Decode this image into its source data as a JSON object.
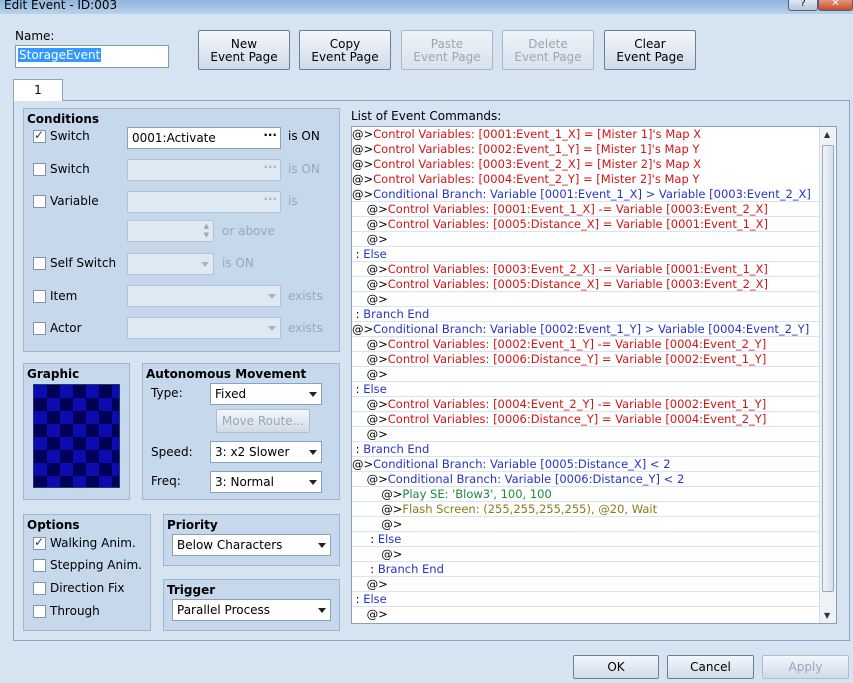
{
  "window": {
    "title": "Edit Event - ID:003",
    "help_glyph": "?",
    "close_glyph": "✕"
  },
  "name": {
    "label": "Name:",
    "value": "StorageEvent"
  },
  "toolbar": {
    "new_page": [
      "New",
      "Event Page"
    ],
    "copy_page": [
      "Copy",
      "Event Page"
    ],
    "paste_page": [
      "Paste",
      "Event Page"
    ],
    "delete_page": [
      "Delete",
      "Event Page"
    ],
    "clear_page": [
      "Clear",
      "Event Page"
    ]
  },
  "tabs": [
    {
      "label": "1"
    }
  ],
  "conditions": {
    "title": "Conditions",
    "switch1": {
      "label": "Switch",
      "checked": true,
      "value": "0001:Activate",
      "suffix": "is ON"
    },
    "switch2": {
      "label": "Switch",
      "checked": false,
      "value": "",
      "suffix": "is ON"
    },
    "variable": {
      "label": "Variable",
      "checked": false,
      "value": "",
      "suffix": "is",
      "or_above": "or above"
    },
    "self_switch": {
      "label": "Self Switch",
      "checked": false,
      "value": "",
      "suffix": "is ON"
    },
    "item": {
      "label": "Item",
      "checked": false,
      "value": "",
      "suffix": "exists"
    },
    "actor": {
      "label": "Actor",
      "checked": false,
      "value": "",
      "suffix": "exists"
    },
    "dots": "···"
  },
  "graphic": {
    "title": "Graphic"
  },
  "movement": {
    "title": "Autonomous Movement",
    "type_label": "Type:",
    "type_value": "Fixed",
    "move_route": "Move Route...",
    "speed_label": "Speed:",
    "speed_value": "3: x2 Slower",
    "freq_label": "Freq:",
    "freq_value": "3: Normal"
  },
  "options": {
    "title": "Options",
    "items": [
      {
        "label": "Walking Anim.",
        "checked": true
      },
      {
        "label": "Stepping Anim.",
        "checked": false
      },
      {
        "label": "Direction Fix",
        "checked": false
      },
      {
        "label": "Through",
        "checked": false
      }
    ]
  },
  "priority": {
    "title": "Priority",
    "value": "Below Characters"
  },
  "trigger": {
    "title": "Trigger",
    "value": "Parallel Process"
  },
  "commands": {
    "title": "List of Event Commands:",
    "rows": [
      {
        "indent": "",
        "prefix": "@>",
        "text": "Control Variables: [0001:Event_1_X] = [Mister 1]'s Map X",
        "color": "red",
        "sep": false
      },
      {
        "indent": "",
        "prefix": "@>",
        "text": "Control Variables: [0002:Event_1_Y] = [Mister 1]'s Map Y",
        "color": "red",
        "sep": false
      },
      {
        "indent": "",
        "prefix": "@>",
        "text": "Control Variables: [0003:Event_2_X] = [Mister 2]'s Map X",
        "color": "red",
        "sep": false
      },
      {
        "indent": "",
        "prefix": "@>",
        "text": "Control Variables: [0004:Event_2_Y] = [Mister 2]'s Map Y",
        "color": "red",
        "sep": false
      },
      {
        "indent": "",
        "prefix": "@>",
        "text": "Conditional Branch: Variable [0001:Event_1_X] > Variable [0003:Event_2_X]",
        "color": "blue",
        "sep": true
      },
      {
        "indent": "    ",
        "prefix": "@>",
        "text": "Control Variables: [0001:Event_1_X] -= Variable [0003:Event_2_X]",
        "color": "red",
        "sep": true
      },
      {
        "indent": "    ",
        "prefix": "@>",
        "text": "Control Variables: [0005:Distance_X] = Variable [0001:Event_1_X]",
        "color": "red",
        "sep": true
      },
      {
        "indent": "    ",
        "prefix": "@>",
        "text": "",
        "color": "black",
        "sep": true
      },
      {
        "indent": "",
        "prefix": " : ",
        "text": "Else",
        "color": "blue",
        "sep": true
      },
      {
        "indent": "    ",
        "prefix": "@>",
        "text": "Control Variables: [0003:Event_2_X] -= Variable [0001:Event_1_X]",
        "color": "red",
        "sep": true
      },
      {
        "indent": "    ",
        "prefix": "@>",
        "text": "Control Variables: [0005:Distance_X] = Variable [0003:Event_2_X]",
        "color": "red",
        "sep": true
      },
      {
        "indent": "    ",
        "prefix": "@>",
        "text": "",
        "color": "black",
        "sep": true
      },
      {
        "indent": "",
        "prefix": " : ",
        "text": "Branch End",
        "color": "blue",
        "sep": true
      },
      {
        "indent": "",
        "prefix": "@>",
        "text": "Conditional Branch: Variable [0002:Event_1_Y] > Variable [0004:Event_2_Y]",
        "color": "blue",
        "sep": true
      },
      {
        "indent": "    ",
        "prefix": "@>",
        "text": "Control Variables: [0002:Event_1_Y] -= Variable [0004:Event_2_Y]",
        "color": "red",
        "sep": true
      },
      {
        "indent": "    ",
        "prefix": "@>",
        "text": "Control Variables: [0006:Distance_Y] = Variable [0002:Event_1_Y]",
        "color": "red",
        "sep": true
      },
      {
        "indent": "    ",
        "prefix": "@>",
        "text": "",
        "color": "black",
        "sep": true
      },
      {
        "indent": "",
        "prefix": " : ",
        "text": "Else",
        "color": "blue",
        "sep": true
      },
      {
        "indent": "    ",
        "prefix": "@>",
        "text": "Control Variables: [0004:Event_2_Y] -= Variable [0002:Event_1_Y]",
        "color": "red",
        "sep": true
      },
      {
        "indent": "    ",
        "prefix": "@>",
        "text": "Control Variables: [0006:Distance_Y] = Variable [0004:Event_2_Y]",
        "color": "red",
        "sep": true
      },
      {
        "indent": "    ",
        "prefix": "@>",
        "text": "",
        "color": "black",
        "sep": true
      },
      {
        "indent": "",
        "prefix": " : ",
        "text": "Branch End",
        "color": "blue",
        "sep": true
      },
      {
        "indent": "",
        "prefix": "@>",
        "text": "Conditional Branch: Variable [0005:Distance_X] < 2",
        "color": "blue",
        "sep": true
      },
      {
        "indent": "    ",
        "prefix": "@>",
        "text": "Conditional Branch: Variable [0006:Distance_Y] < 2",
        "color": "blue",
        "sep": true
      },
      {
        "indent": "        ",
        "prefix": "@>",
        "text": "Play SE: 'Blow3', 100, 100",
        "color": "green",
        "sep": true
      },
      {
        "indent": "        ",
        "prefix": "@>",
        "text": "Flash Screen: (255,255,255,255), @20, Wait",
        "color": "olive",
        "sep": true
      },
      {
        "indent": "        ",
        "prefix": "@>",
        "text": "",
        "color": "black",
        "sep": true
      },
      {
        "indent": "    ",
        "prefix": " : ",
        "text": "Else",
        "color": "blue",
        "sep": true
      },
      {
        "indent": "        ",
        "prefix": "@>",
        "text": "",
        "color": "black",
        "sep": true
      },
      {
        "indent": "    ",
        "prefix": " : ",
        "text": "Branch End",
        "color": "blue",
        "sep": true
      },
      {
        "indent": "    ",
        "prefix": "@>",
        "text": "",
        "color": "black",
        "sep": true
      },
      {
        "indent": "",
        "prefix": " : ",
        "text": "Else",
        "color": "blue",
        "sep": true
      },
      {
        "indent": "    ",
        "prefix": "@>",
        "text": "",
        "color": "black",
        "sep": false
      }
    ]
  },
  "footer": {
    "ok": "OK",
    "cancel": "Cancel",
    "apply": "Apply"
  },
  "colors": {
    "red": "#d31515",
    "blue": "#2633c9",
    "green": "#1a8a3a",
    "olive": "#8a7b14"
  }
}
